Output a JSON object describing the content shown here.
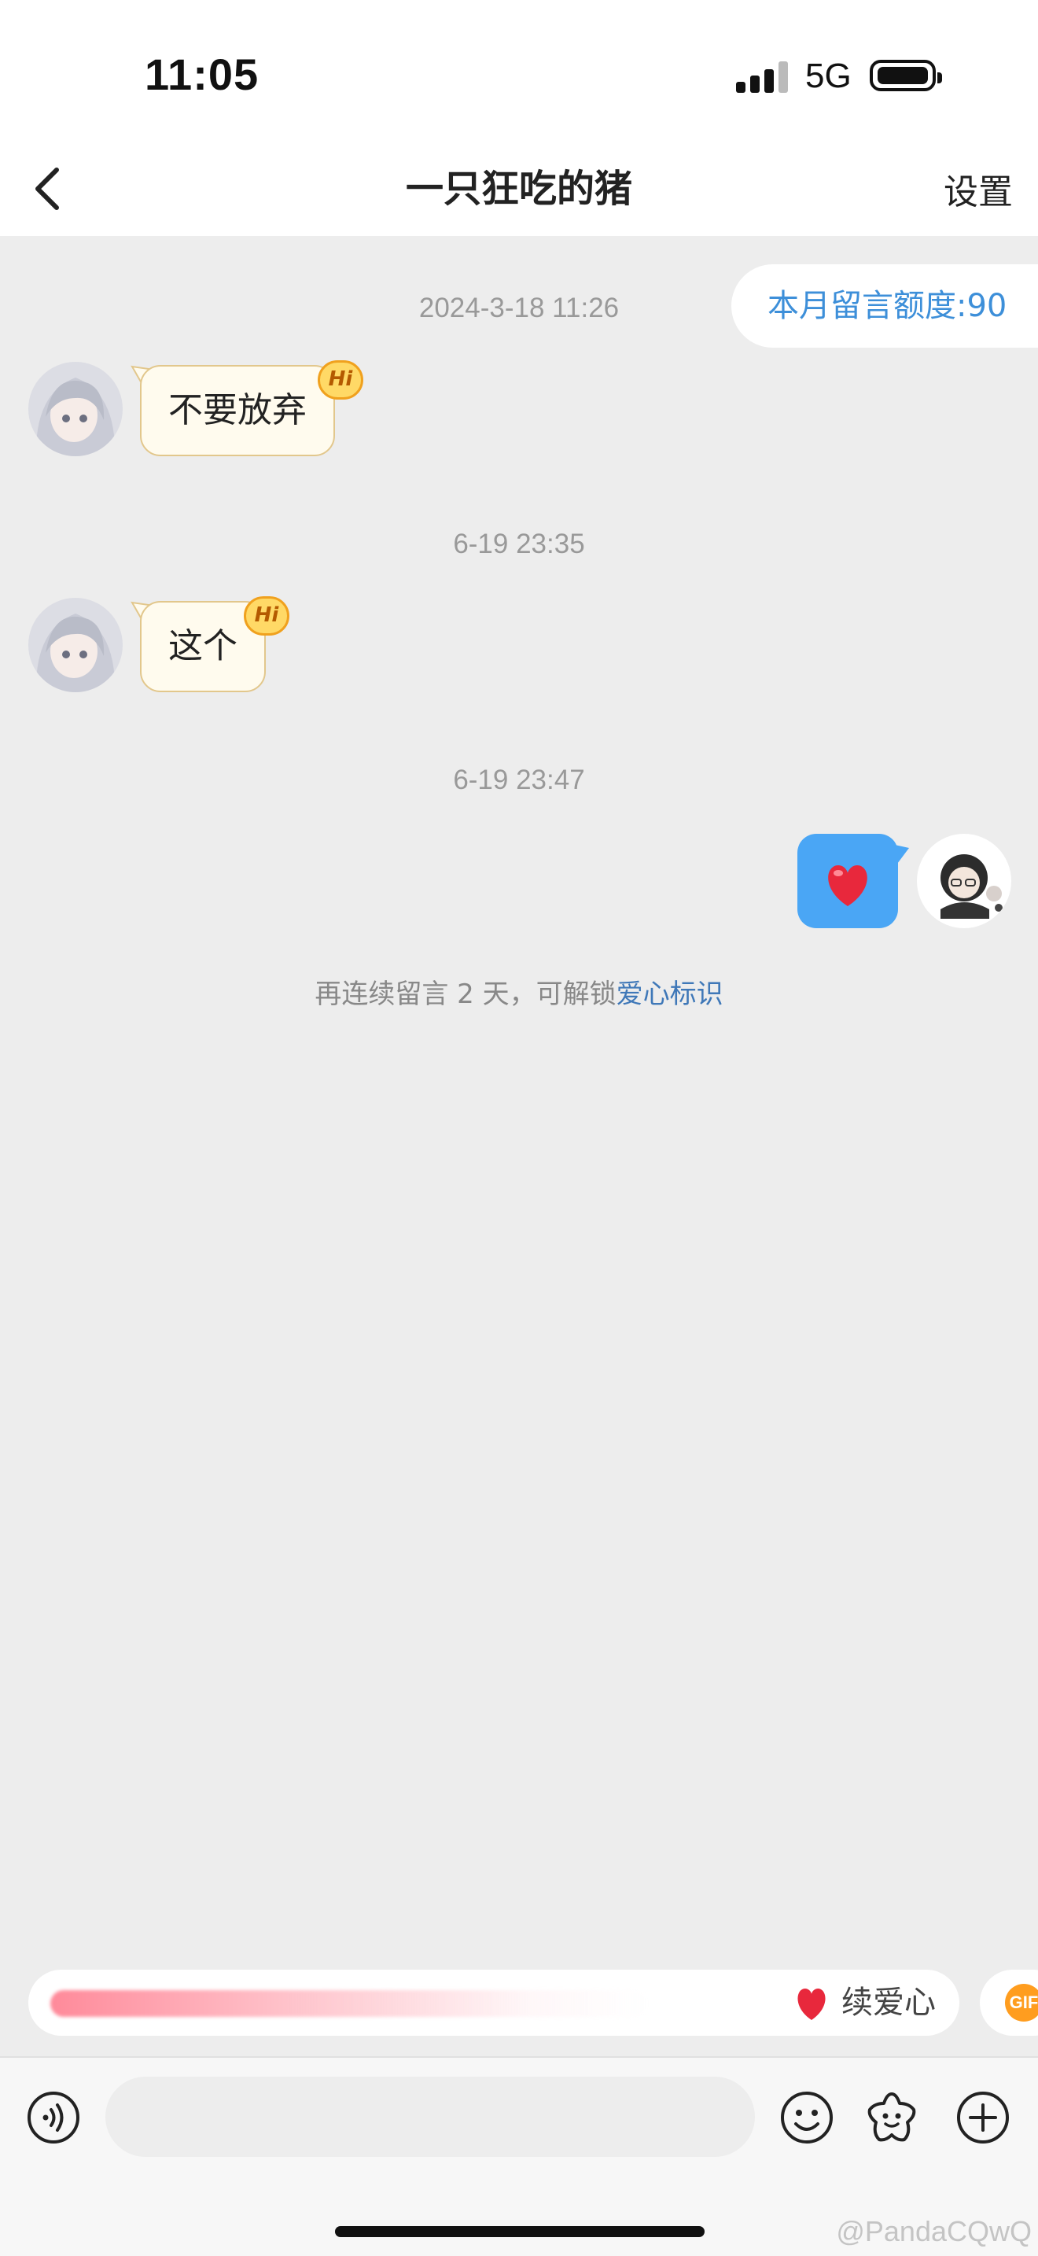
{
  "status_bar": {
    "time": "11:05",
    "network": "5G"
  },
  "nav": {
    "title": "一只狂吃的猪",
    "settings_label": "设置"
  },
  "quota": {
    "text": "本月留言额度:90"
  },
  "messages": [
    {
      "timestamp": "2024-3-18 11:26",
      "text": "不要放弃",
      "direction": "incoming",
      "badge": "Hi"
    },
    {
      "timestamp": "6-19 23:35",
      "text": "这个",
      "direction": "incoming",
      "badge": "Hi"
    },
    {
      "timestamp": "6-19 23:47",
      "emoji": "red-heart",
      "direction": "outgoing"
    }
  ],
  "hint": {
    "prefix": "再连续留言 2 天，可解锁",
    "link": "爱心标识"
  },
  "streak_bar": {
    "label": "续爱心",
    "icon": "heart-icon",
    "next_chip": "GIF"
  },
  "input": {
    "placeholder": ""
  },
  "watermark": "@PandaCQwQ",
  "colors": {
    "background": "#ededed",
    "link": "#3d8fd9",
    "outgoing_bubble": "#4aa6f5",
    "incoming_bubble": "#fffbee",
    "heart": "#e8283c"
  }
}
